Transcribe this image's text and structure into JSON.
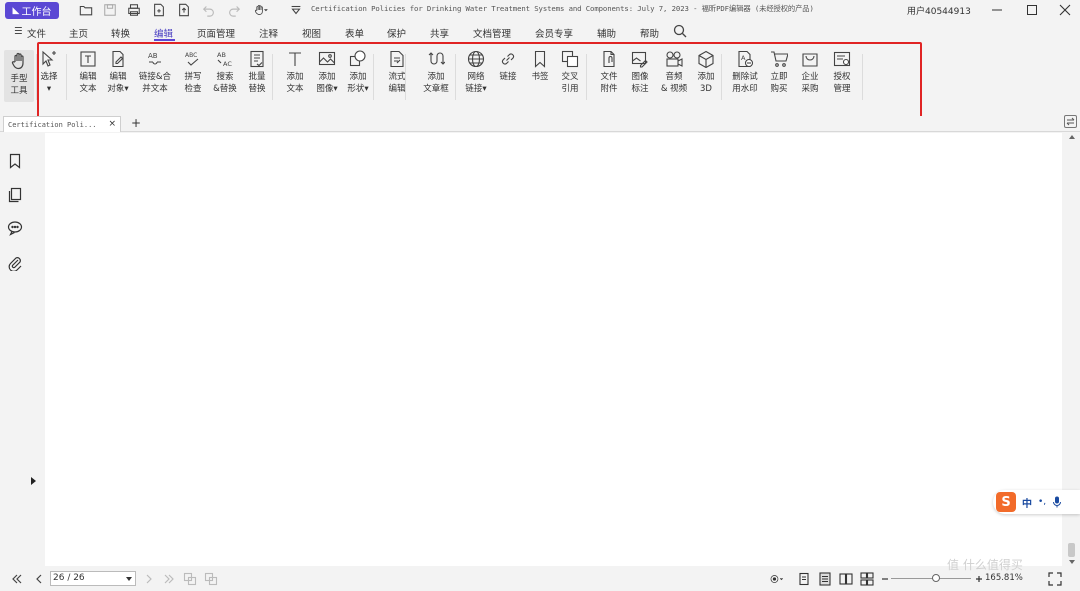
{
  "titlebar": {
    "workbench_label": "工作台",
    "doc_title": "Certification Policies for Drinking Water Treatment Systems and Components: July 7, 2023 - 福昕PDF编辑器 (未经授权的产品)",
    "user_label": "用户40544913"
  },
  "menu": {
    "items": [
      "文件",
      "主页",
      "转换",
      "编辑",
      "页面管理",
      "注释",
      "视图",
      "表单",
      "保护",
      "共享",
      "文档管理",
      "会员专享",
      "辅助",
      "帮助"
    ],
    "active": "编辑"
  },
  "ribbon": {
    "hand_tool": [
      "手型",
      "工具"
    ],
    "tools": [
      {
        "name": "select",
        "label": [
          "选择",
          "▾"
        ],
        "icon": "select-cursor-icon"
      },
      {
        "name": "edit-text",
        "label": [
          "编辑",
          "文本"
        ],
        "icon": "edit-text-icon"
      },
      {
        "name": "edit-object",
        "label": [
          "编辑",
          "对象▾"
        ],
        "icon": "edit-object-icon"
      },
      {
        "name": "link-merge-text",
        "label": [
          "链接&合",
          "并文本"
        ],
        "icon": "link-merge-icon"
      },
      {
        "name": "spell-check",
        "label": [
          "拼写",
          "检查"
        ],
        "icon": "spell-check-icon"
      },
      {
        "name": "search-replace",
        "label": [
          "搜索",
          "&替换"
        ],
        "icon": "search-replace-icon"
      },
      {
        "name": "batch-replace",
        "label": [
          "批量",
          "替换"
        ],
        "icon": "batch-replace-icon"
      },
      {
        "name": "add-text",
        "label": [
          "添加",
          "文本"
        ],
        "icon": "add-text-icon"
      },
      {
        "name": "add-image",
        "label": [
          "添加",
          "图像▾"
        ],
        "icon": "add-image-icon"
      },
      {
        "name": "add-shape",
        "label": [
          "添加",
          "形状▾"
        ],
        "icon": "add-shape-icon"
      },
      {
        "name": "flow-edit",
        "label": [
          "流式",
          "编辑"
        ],
        "icon": "flow-edit-icon"
      },
      {
        "name": "add-article",
        "label": [
          "添加",
          "文章框"
        ],
        "icon": "article-box-icon"
      },
      {
        "name": "web-link",
        "label": [
          "网络",
          "链接▾"
        ],
        "icon": "globe-icon"
      },
      {
        "name": "link",
        "label": [
          "链接",
          ""
        ],
        "icon": "link-icon"
      },
      {
        "name": "bookmark",
        "label": [
          "书签",
          ""
        ],
        "icon": "bookmark-icon"
      },
      {
        "name": "cross-reference",
        "label": [
          "交叉",
          "引用"
        ],
        "icon": "cross-reference-icon"
      },
      {
        "name": "file-attachment",
        "label": [
          "文件",
          "附件"
        ],
        "icon": "file-attachment-icon"
      },
      {
        "name": "image-annotation",
        "label": [
          "图像",
          "标注"
        ],
        "icon": "image-annotation-icon"
      },
      {
        "name": "audio-video",
        "label": [
          "音频",
          "& 视频"
        ],
        "icon": "video-icon"
      },
      {
        "name": "add-3d",
        "label": [
          "添加",
          "3D"
        ],
        "icon": "cube-3d-icon"
      },
      {
        "name": "remove-watermark",
        "label": [
          "删除试",
          "用水印"
        ],
        "icon": "remove-watermark-icon"
      },
      {
        "name": "buy-now",
        "label": [
          "立即",
          "购买"
        ],
        "icon": "cart-icon"
      },
      {
        "name": "enterprise-purchase",
        "label": [
          "企业",
          "采购"
        ],
        "icon": "enterprise-bag-icon"
      },
      {
        "name": "license-manage",
        "label": [
          "授权",
          "管理"
        ],
        "icon": "license-icon"
      }
    ]
  },
  "doctab": {
    "label": "Certification Poli...",
    "close": "×",
    "add": "+"
  },
  "ime": {
    "logo": "S",
    "lang": "中",
    "dots": "•,"
  },
  "statusbar": {
    "page_value": "26 / 26",
    "zoom": "165.81%"
  },
  "watermark": "值 什么值得买",
  "colors": {
    "accent": "#5b48d4",
    "highlight_border": "#e02424",
    "ime_orange": "#f26b2a"
  }
}
